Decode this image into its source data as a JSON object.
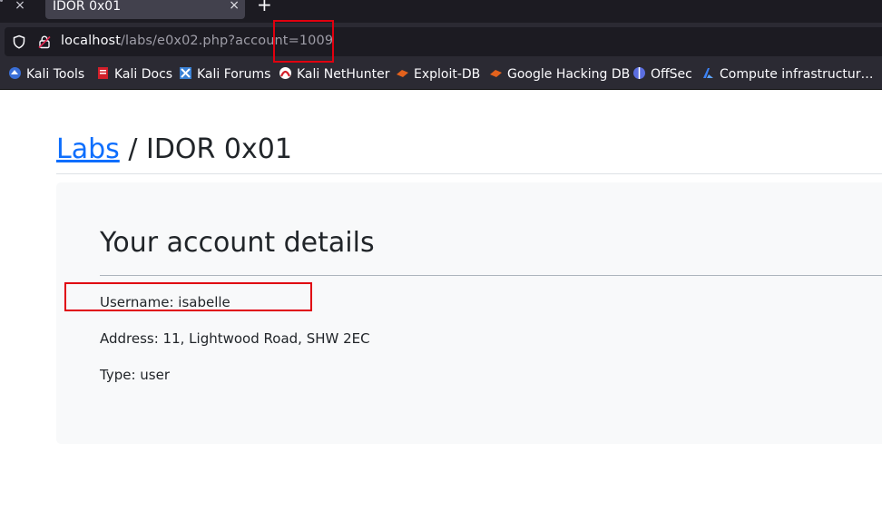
{
  "browser": {
    "tab_title": "IDOR 0x01",
    "tab_close": "×",
    "prev_tab_close": "×",
    "new_tab": "+",
    "url_host": "localhost",
    "url_path": "/labs/e0x02.php?account=1009"
  },
  "bookmarks": [
    {
      "label": "Kali Tools",
      "icon": "kali-tools-icon",
      "color": "#3a6fd8"
    },
    {
      "label": "Kali Docs",
      "icon": "kali-docs-icon",
      "color": "#d21f2a"
    },
    {
      "label": "Kali Forums",
      "icon": "kali-forums-icon",
      "color": "#3b82d6"
    },
    {
      "label": "Kali NetHunter",
      "icon": "kali-nethunter-icon",
      "color": "#d21f2a"
    },
    {
      "label": "Exploit-DB",
      "icon": "exploit-db-icon",
      "color": "#e3621d"
    },
    {
      "label": "Google Hacking DB",
      "icon": "ghdb-icon",
      "color": "#e3621d"
    },
    {
      "label": "OffSec",
      "icon": "offsec-icon",
      "color": "#5b6ee1"
    },
    {
      "label": "Compute infrastructur…",
      "icon": "compute-icon",
      "color": "#3b82f6"
    }
  ],
  "page": {
    "breadcrumb_link": "Labs",
    "breadcrumb_separator": " / ",
    "breadcrumb_current": "IDOR 0x01",
    "card_title": "Your account details",
    "username": "Username: isabelle",
    "address": "Address: 11, Lightwood Road, SHW 2EC",
    "type": "Type: user"
  },
  "colors": {
    "link": "#0d6efd",
    "annotation": "#e0000f",
    "card_bg": "#f8f9fa"
  }
}
